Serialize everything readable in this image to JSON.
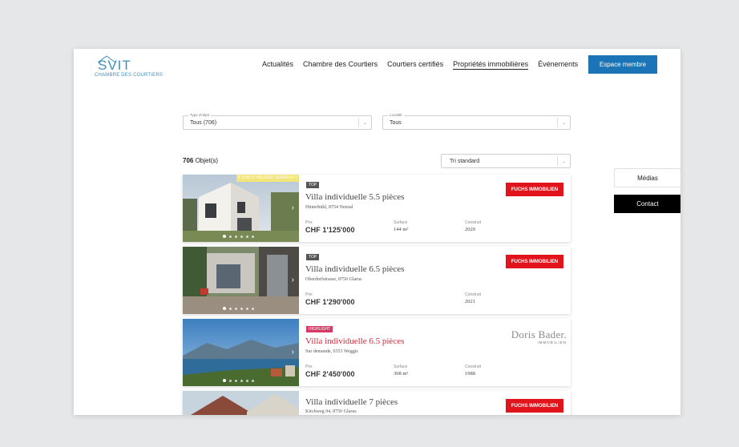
{
  "header": {
    "logo_text": "SVIT",
    "logo_sub": "CHAMBRE DES COURTIERS",
    "nav": [
      "Actualités",
      "Chambre des Courtiers",
      "Courtiers certifiés",
      "Propriétés immobilières",
      "Événements"
    ],
    "active_nav": "Propriétés immobilières",
    "member_button": "Espace membre"
  },
  "filters": {
    "type": {
      "label": "Type d'objet",
      "value": "Tous (706)"
    },
    "locality": {
      "label": "Localité",
      "value": "Tous"
    },
    "sort": {
      "value": "Tri standard"
    }
  },
  "results": {
    "count": "706",
    "suffix": " Objet(s)"
  },
  "side": {
    "medias": "Médias",
    "contact": "Contact"
  },
  "listings": [
    {
      "ribbon": "5 VON 5 HÄUSER VERKAUFT",
      "badge": "TOP",
      "title": "Villa individuelle 5.5 pièces",
      "address": "Hinterbühl, 8754 Netstal",
      "price_label": "Prix",
      "price": "CHF 1'125'000",
      "surface_label": "Surface",
      "surface": "144 m²",
      "built_label": "Construit",
      "built": "2020",
      "agency": "FUCHS IMMOBILIEN"
    },
    {
      "badge": "TOP",
      "title": "Villa individuelle 6.5 pièces",
      "address": "Oberdorfstrasse, 8750 Glarus",
      "price_label": "Prix",
      "price": "CHF 1'290'000",
      "built_label": "Construit",
      "built": "2021",
      "agency": "FUCHS IMMOBILIEN"
    },
    {
      "badge": "HIGHLIGHT",
      "title": "Villa individuelle 6.5 pièces",
      "address": "Sur demande, 6353 Weggis",
      "price_label": "Prix",
      "price": "CHF 2'450'000",
      "surface_label": "Surface",
      "surface": "308 m²",
      "built_label": "Construit",
      "built": "1988",
      "agency_name": "Doris Bader.",
      "agency_sub": "IMMOBILIEN"
    },
    {
      "title": "Villa individuelle 7 pièces",
      "address": "Kirchweg 94, 8750 Glarus",
      "agency": "FUCHS IMMOBILIEN"
    }
  ],
  "colors": {
    "accent": "#1a74b5",
    "agency_red": "#e2141b",
    "highlight": "#d83a67",
    "title_red": "#d42a3a"
  }
}
